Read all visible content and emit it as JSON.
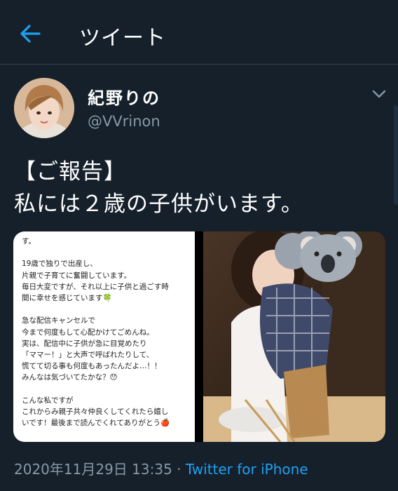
{
  "header": {
    "title": "ツイート",
    "back_icon": "arrow-left-icon"
  },
  "author": {
    "display_name": "紀野りの",
    "handle": "@VVrinon",
    "avatar_icon": "user-avatar",
    "caret_icon": "chevron-down-icon"
  },
  "tweet": {
    "line1": "【ご報告】",
    "line2": "私には２歳の子供がいます。"
  },
  "media": {
    "left_image_text": "す。\n\n19歳で独りで出産し、\n片親で子育てに奮闘しています。\n毎日大変ですが、それ以上に子供と過ごす時\n間に幸せを感じています🍀\n\n急な配信キャンセルで\n今まで何度もして心配かけてごめんね。\n実は、配信中に子供が急に目覚めたり\n「ママー！」と大声で呼ばれたりして、\n慌てて切る事も何度もあったんだよ…！！\nみんなは気づいてたかな？😯\n\nこんな私ですが\nこれからみ親子共々仲良くしてくれたら嬉し\nいです！最後まで読んでくれてありがとう🍎",
    "right_image_icon": "koala-sticker-icon"
  },
  "meta": {
    "timestamp": "2020年11月29日 13:35",
    "separator": " · ",
    "source": "Twitter for iPhone"
  },
  "colors": {
    "background": "#15202b",
    "accent": "#1da1f2",
    "muted": "#8899a6"
  }
}
